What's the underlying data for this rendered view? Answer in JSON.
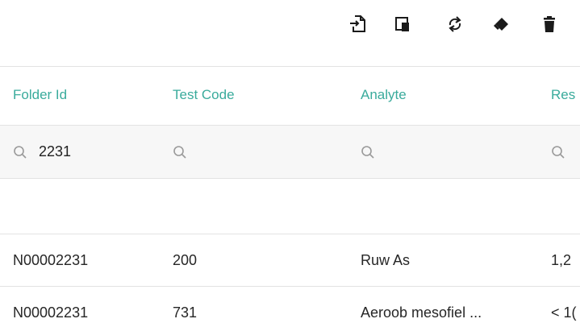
{
  "toolbar": {
    "icons": [
      "import-file-icon",
      "copy-document-icon",
      "refresh-icon",
      "eraser-icon",
      "trash-icon"
    ]
  },
  "table": {
    "columns": [
      {
        "label": "Folder Id"
      },
      {
        "label": "Test Code"
      },
      {
        "label": "Analyte"
      },
      {
        "label": "Res"
      }
    ],
    "filters": {
      "folder_id": "2231",
      "test_code": "",
      "analyte": "",
      "result": ""
    },
    "rows": [
      {
        "folder_id": "N00002231",
        "test_code": "200",
        "analyte": "Ruw As",
        "result": "1,2"
      },
      {
        "folder_id": "N00002231",
        "test_code": "731",
        "analyte": "Aeroob mesofiel ...",
        "result": "< 1("
      }
    ]
  },
  "colors": {
    "accent": "#3aab9c",
    "text": "#262626",
    "filter_bg": "#f7f7f7",
    "border": "#e3e3e3",
    "icon": "#1a1a1a"
  }
}
